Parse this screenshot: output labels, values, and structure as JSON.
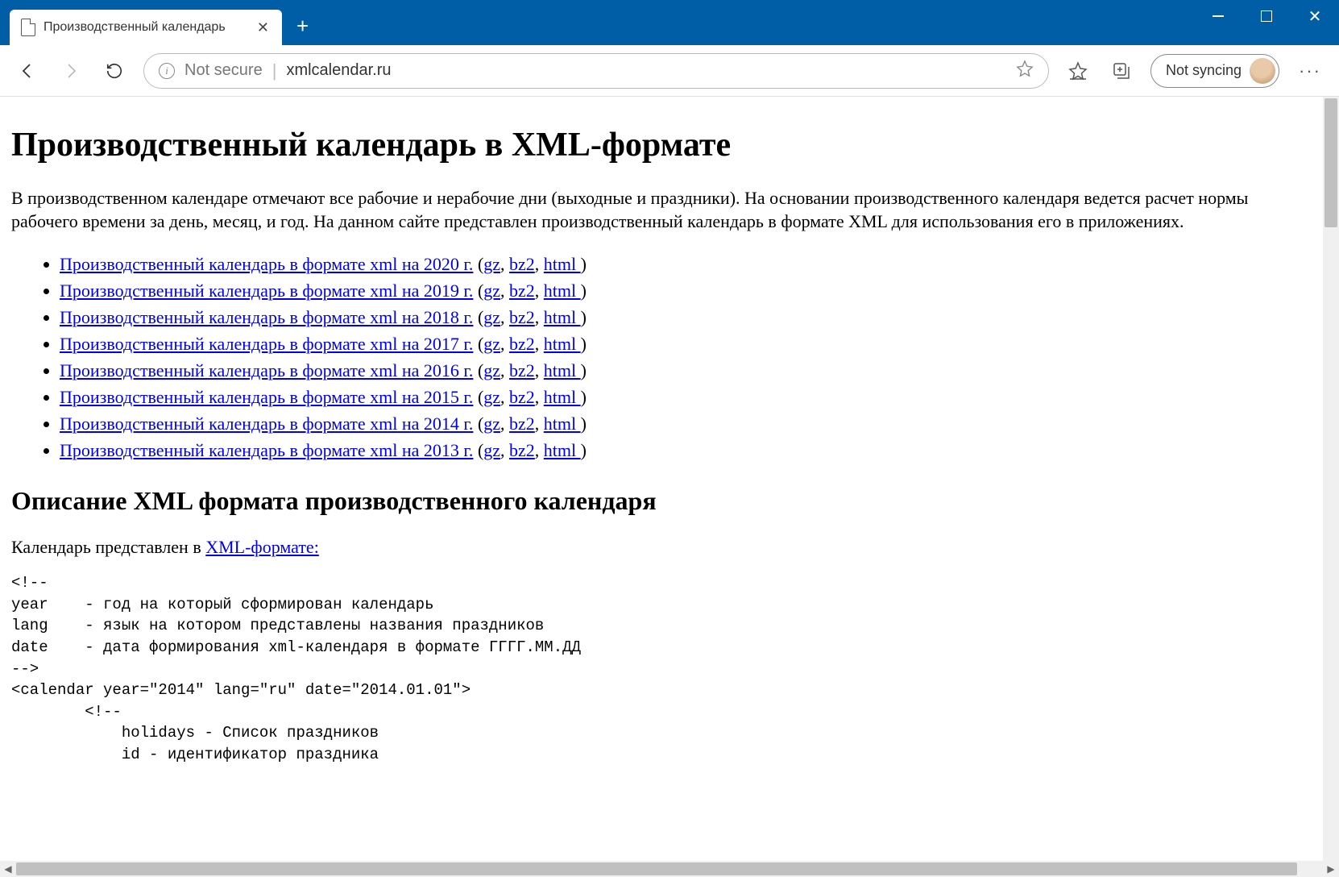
{
  "browser": {
    "tab_title": "Производственный календарь",
    "not_secure_label": "Not secure",
    "url": "xmlcalendar.ru",
    "sync_label": "Not syncing"
  },
  "page": {
    "h1": "Производственный календарь в XML-формате",
    "intro": "В производственном календаре отмечают все рабочие и нерабочие дни (выходные и праздники). На основании производственного календаря ведется расчет нормы рабочего времени за день, месяц, и год. На данном сайте представлен производственный календарь в формате XML для использования его в приложениях.",
    "link_prefix": "Производственный календарь в формате xml на ",
    "link_suffix": " г.",
    "years": [
      "2020",
      "2019",
      "2018",
      "2017",
      "2016",
      "2015",
      "2014",
      "2013"
    ],
    "alt_gz": "gz",
    "alt_bz2": "bz2",
    "alt_html": "html ",
    "h2": "Описание XML формата производственного календаря",
    "sub_prefix": "Календарь представлен в ",
    "sub_link": "XML-формате:",
    "code": "<!--\nyear    - год на который сформирован календарь\nlang    - язык на котором представлены названия праздников\ndate    - дата формирования xml-календаря в формате ГГГГ.ММ.ДД\n-->\n<calendar year=\"2014\" lang=\"ru\" date=\"2014.01.01\">\n        <!--\n            holidays - Список праздников\n            id - идентификатор праздника"
  }
}
